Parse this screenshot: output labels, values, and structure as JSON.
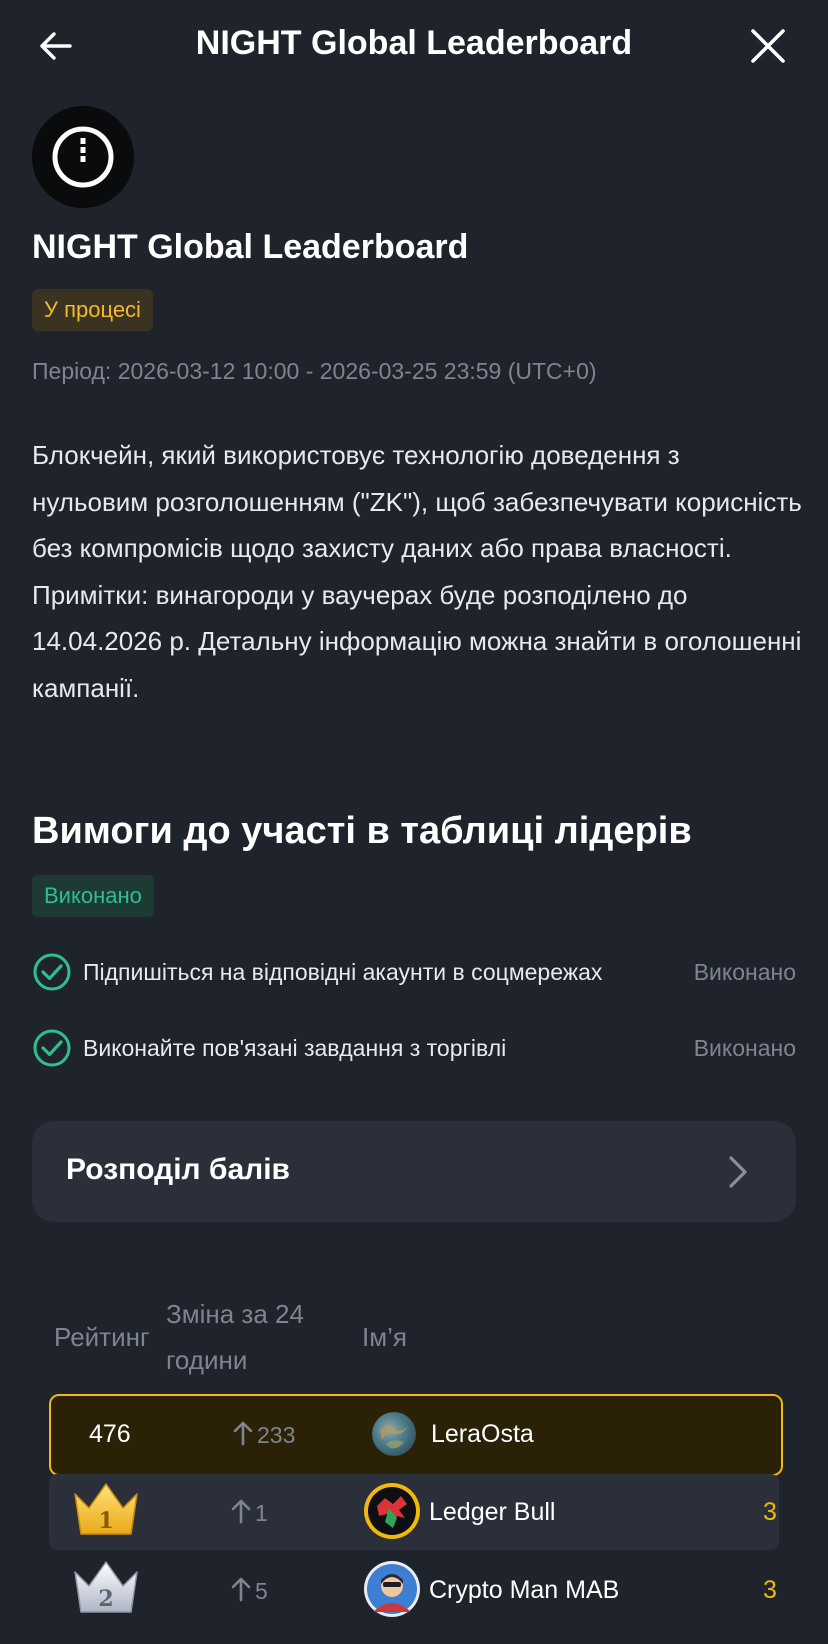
{
  "header": {
    "title": "NIGHT Global Leaderboard",
    "back_icon": "arrow-left-icon",
    "close_icon": "close-icon"
  },
  "campaign": {
    "logo_icon": "night-logo-icon",
    "title": "NIGHT Global Leaderboard",
    "status": "У процесі",
    "period": "Період: 2026-03-12 10:00 - 2026-03-25 23:59 (UTC+0)",
    "description": "Блокчейн, який використовує технологію доведення з нульовим розголошенням (\"ZK\"), щоб забезпечувати корисність без компромісів щодо захисту даних або права власності. Примітки: винагороди у ваучерах буде розподілено до 14.04.2026 р. Детальну інформацію можна знайти в оголошенні кампанії."
  },
  "requirements": {
    "title": "Вимоги до участі в таблиці лідерів",
    "status": "Виконано",
    "items": [
      {
        "label": "Підпишіться на відповідні акаунти в соцмережах",
        "status": "Виконано"
      },
      {
        "label": "Виконайте пов'язані завдання з торгівлі",
        "status": "Виконано"
      }
    ]
  },
  "points": {
    "label": "Розподіл балів"
  },
  "leaderboard": {
    "columns": {
      "rank": "Рейтинг",
      "change_line1": "Зміна за 24",
      "change_line2": "години",
      "name": "Ім’я"
    },
    "rows": [
      {
        "rank": "476",
        "change": "233",
        "name": "LeraOsta",
        "score": ""
      },
      {
        "rank": "1",
        "change": "1",
        "name": "Ledger Bull",
        "score": "3"
      },
      {
        "rank": "2",
        "change": "5",
        "name": "Crypto Man MAB",
        "score": "3"
      }
    ]
  },
  "colors": {
    "accent": "#f0b90b",
    "success": "#2fbf8a",
    "background": "#1f232b",
    "card": "#2a2f3a",
    "muted": "#7f8590"
  }
}
